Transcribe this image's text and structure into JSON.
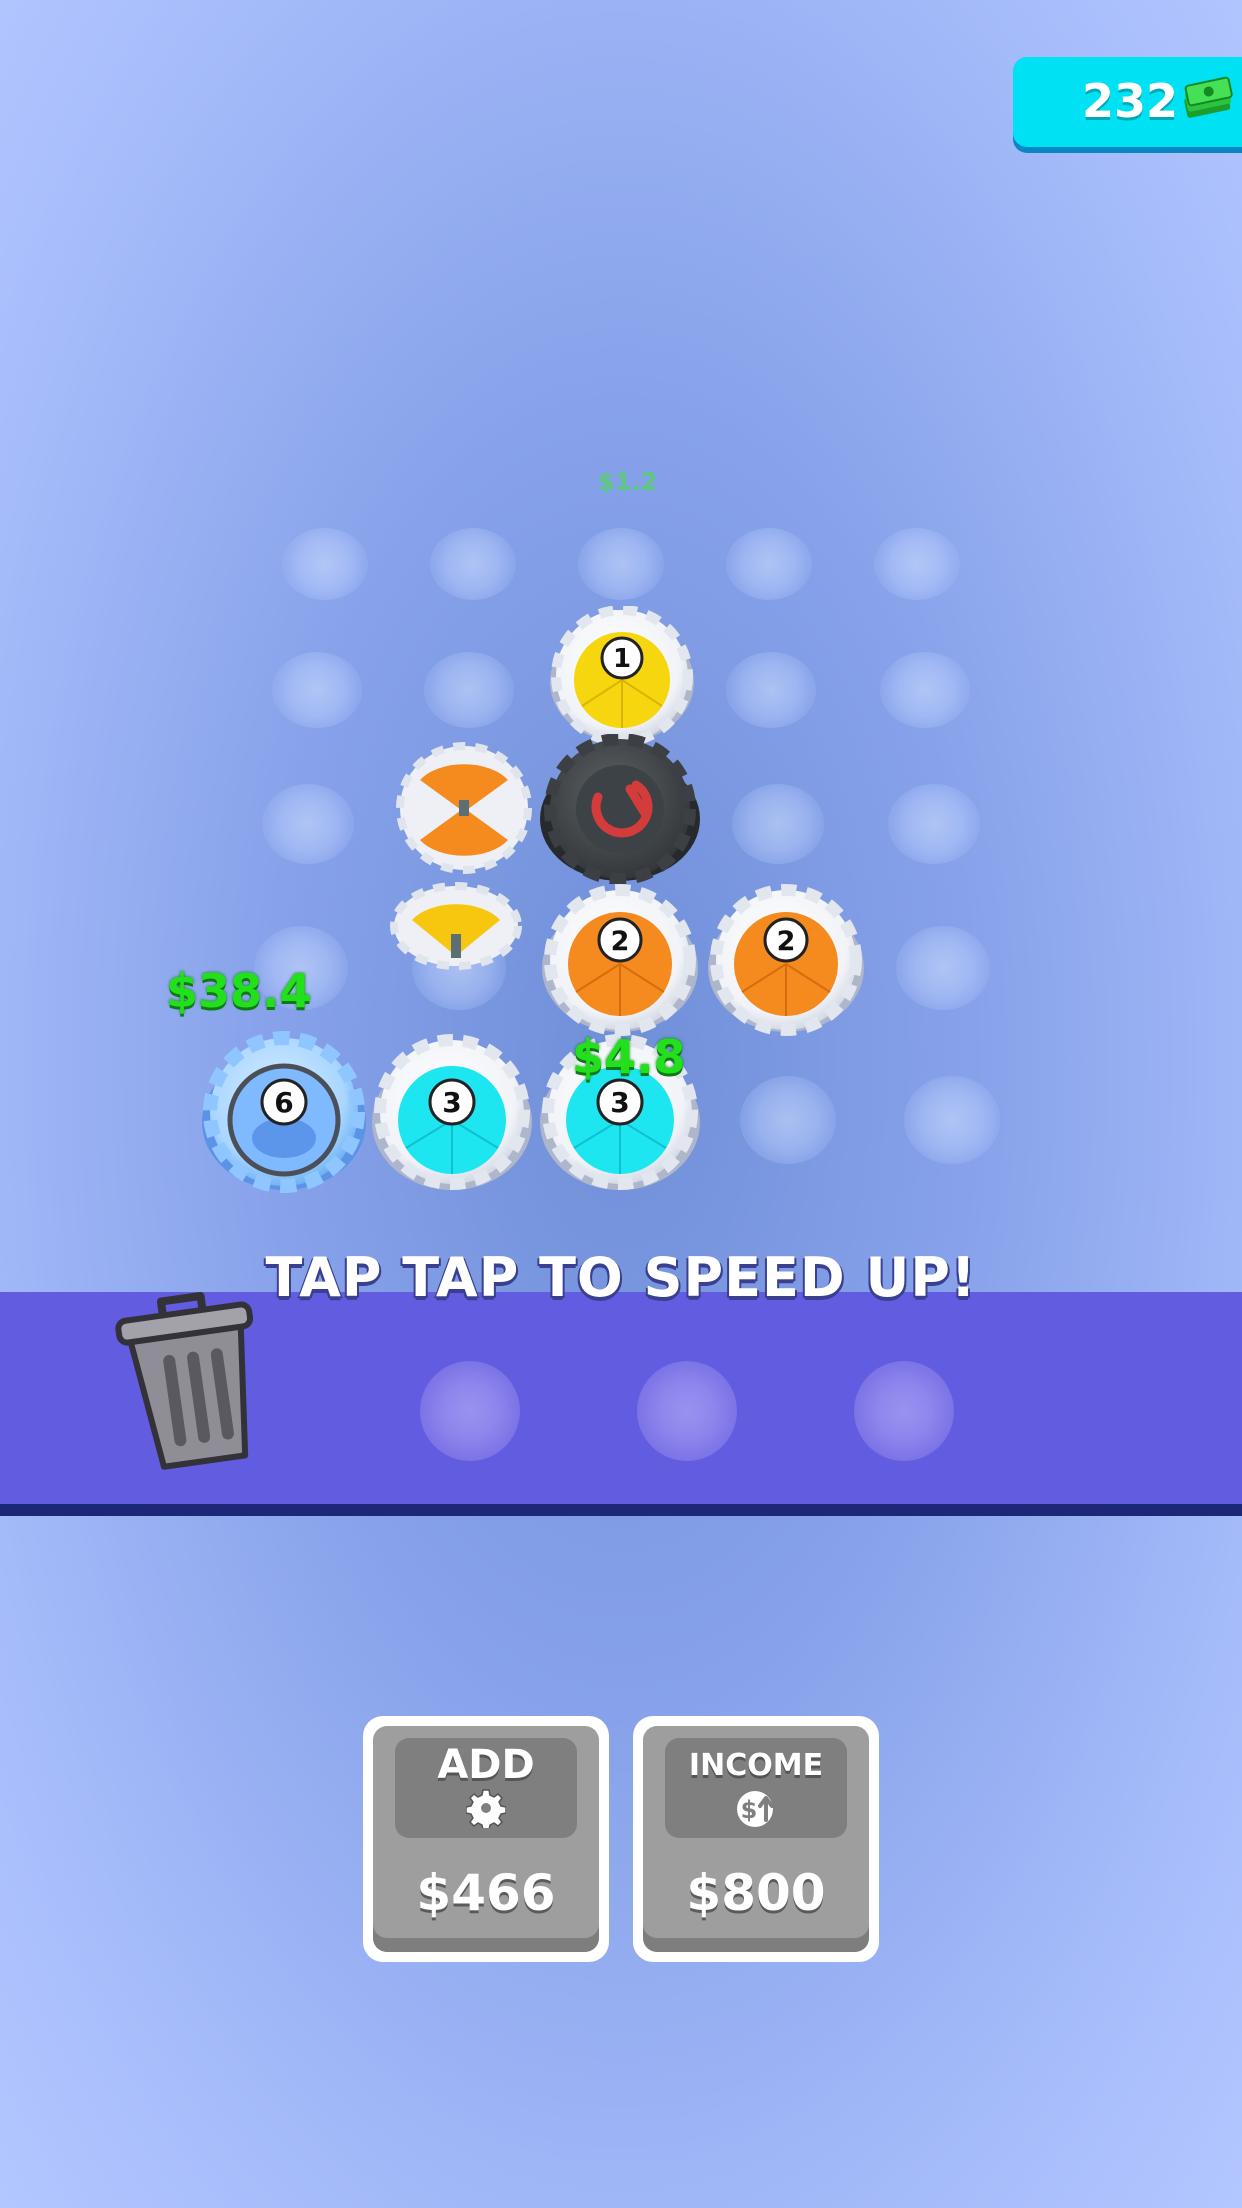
{
  "hud": {
    "money": "232",
    "money_icon": "cash-stack-icon"
  },
  "floating_income": {
    "a": "$1.2",
    "b": "$38.4",
    "c": "$4.8"
  },
  "gears": [
    {
      "level": "1",
      "color": "#f6d60e"
    },
    {
      "level": "2",
      "color": "#f58a1f"
    },
    {
      "level": "2",
      "color": "#f58a1f"
    },
    {
      "level": "6",
      "color": "#6fb6ff"
    },
    {
      "level": "3",
      "color": "#1de6f0"
    },
    {
      "level": "3",
      "color": "#1de6f0"
    }
  ],
  "instruction": "TAP TAP TO SPEED UP!",
  "buttons": {
    "add": {
      "label": "ADD",
      "icon": "gear-icon",
      "price": "$466"
    },
    "income": {
      "label": "INCOME",
      "icon": "dollar-up-icon",
      "price": "$800"
    }
  },
  "trash_icon": "trash-can-icon",
  "colors": {
    "accent": "#00e1f4",
    "tray": "#625ce0",
    "income_green": "#23e01d"
  }
}
